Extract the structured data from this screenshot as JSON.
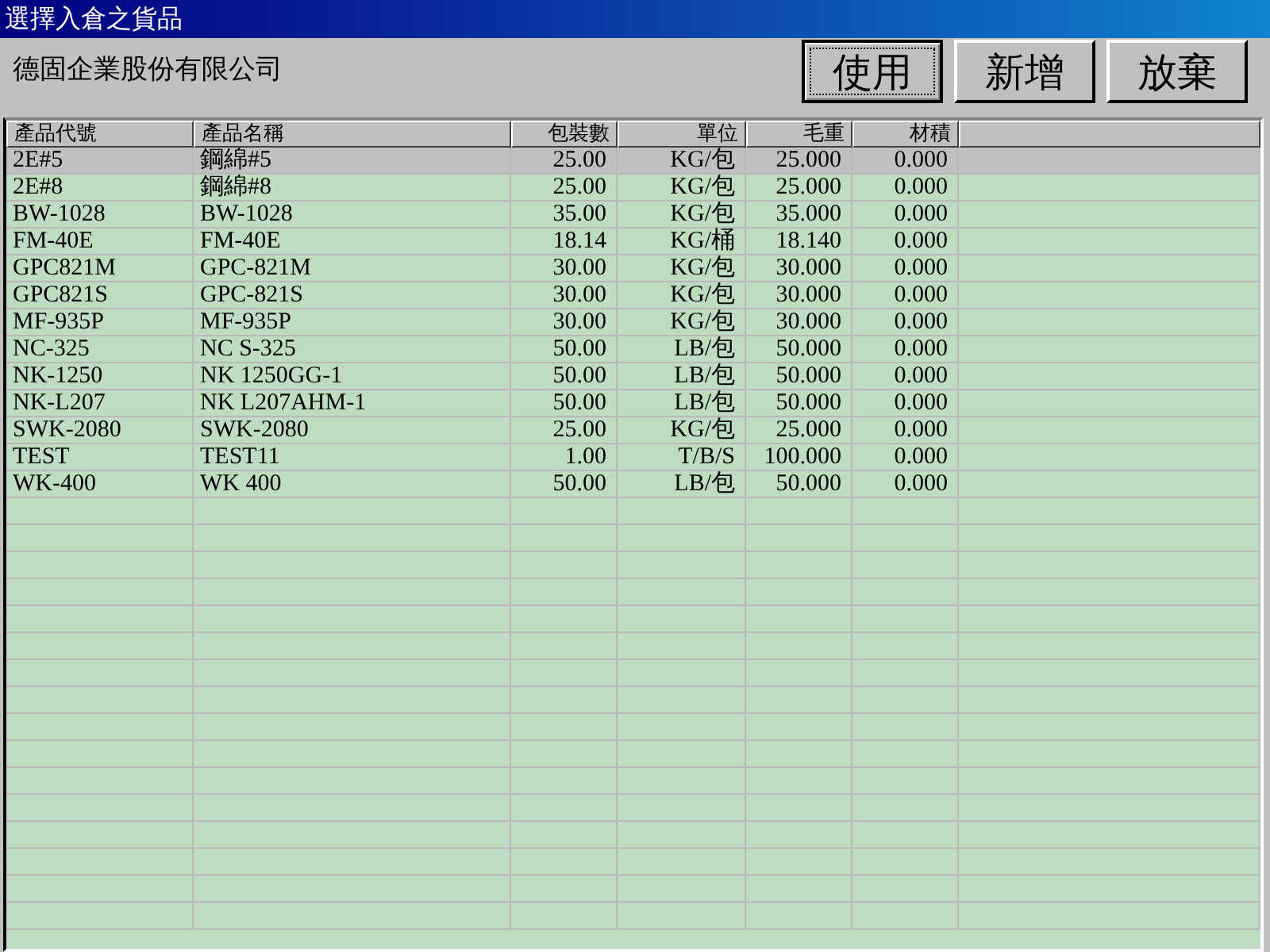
{
  "window": {
    "title": "選擇入倉之貨品"
  },
  "company": "德固企業股份有限公司",
  "buttons": [
    {
      "label": "使用",
      "focused": true
    },
    {
      "label": "新增",
      "focused": false
    },
    {
      "label": "放棄",
      "focused": false
    }
  ],
  "table": {
    "columns": [
      {
        "label": "產品代號"
      },
      {
        "label": "產品名稱"
      },
      {
        "label": "包裝數"
      },
      {
        "label": "單位"
      },
      {
        "label": "毛重"
      },
      {
        "label": "材積"
      }
    ],
    "rows": [
      {
        "cells": [
          "2E#5",
          "鋼綿#5",
          "25.00",
          "KG/包",
          "25.000",
          "0.000"
        ],
        "selected": true
      },
      {
        "cells": [
          "2E#8",
          "鋼綿#8",
          "25.00",
          "KG/包",
          "25.000",
          "0.000"
        ],
        "selected": false
      },
      {
        "cells": [
          "BW-1028",
          "BW-1028",
          "35.00",
          "KG/包",
          "35.000",
          "0.000"
        ],
        "selected": false
      },
      {
        "cells": [
          "FM-40E",
          "FM-40E",
          "18.14",
          "KG/桶",
          "18.140",
          "0.000"
        ],
        "selected": false
      },
      {
        "cells": [
          "GPC821M",
          "GPC-821M",
          "30.00",
          "KG/包",
          "30.000",
          "0.000"
        ],
        "selected": false
      },
      {
        "cells": [
          "GPC821S",
          "GPC-821S",
          "30.00",
          "KG/包",
          "30.000",
          "0.000"
        ],
        "selected": false
      },
      {
        "cells": [
          "MF-935P",
          "MF-935P",
          "30.00",
          "KG/包",
          "30.000",
          "0.000"
        ],
        "selected": false
      },
      {
        "cells": [
          "NC-325",
          "NC S-325",
          "50.00",
          "LB/包",
          "50.000",
          "0.000"
        ],
        "selected": false
      },
      {
        "cells": [
          "NK-1250",
          "NK 1250GG-1",
          "50.00",
          "LB/包",
          "50.000",
          "0.000"
        ],
        "selected": false
      },
      {
        "cells": [
          "NK-L207",
          "NK L207AHM-1",
          "50.00",
          "LB/包",
          "50.000",
          "0.000"
        ],
        "selected": false
      },
      {
        "cells": [
          "SWK-2080",
          "SWK-2080",
          "25.00",
          "KG/包",
          "25.000",
          "0.000"
        ],
        "selected": false
      },
      {
        "cells": [
          "TEST",
          "TEST11",
          "1.00",
          "T/B/S",
          "100.000",
          "0.000"
        ],
        "selected": false
      },
      {
        "cells": [
          "WK-400",
          "WK 400",
          "50.00",
          "LB/包",
          "50.000",
          "0.000"
        ],
        "selected": false
      }
    ]
  }
}
